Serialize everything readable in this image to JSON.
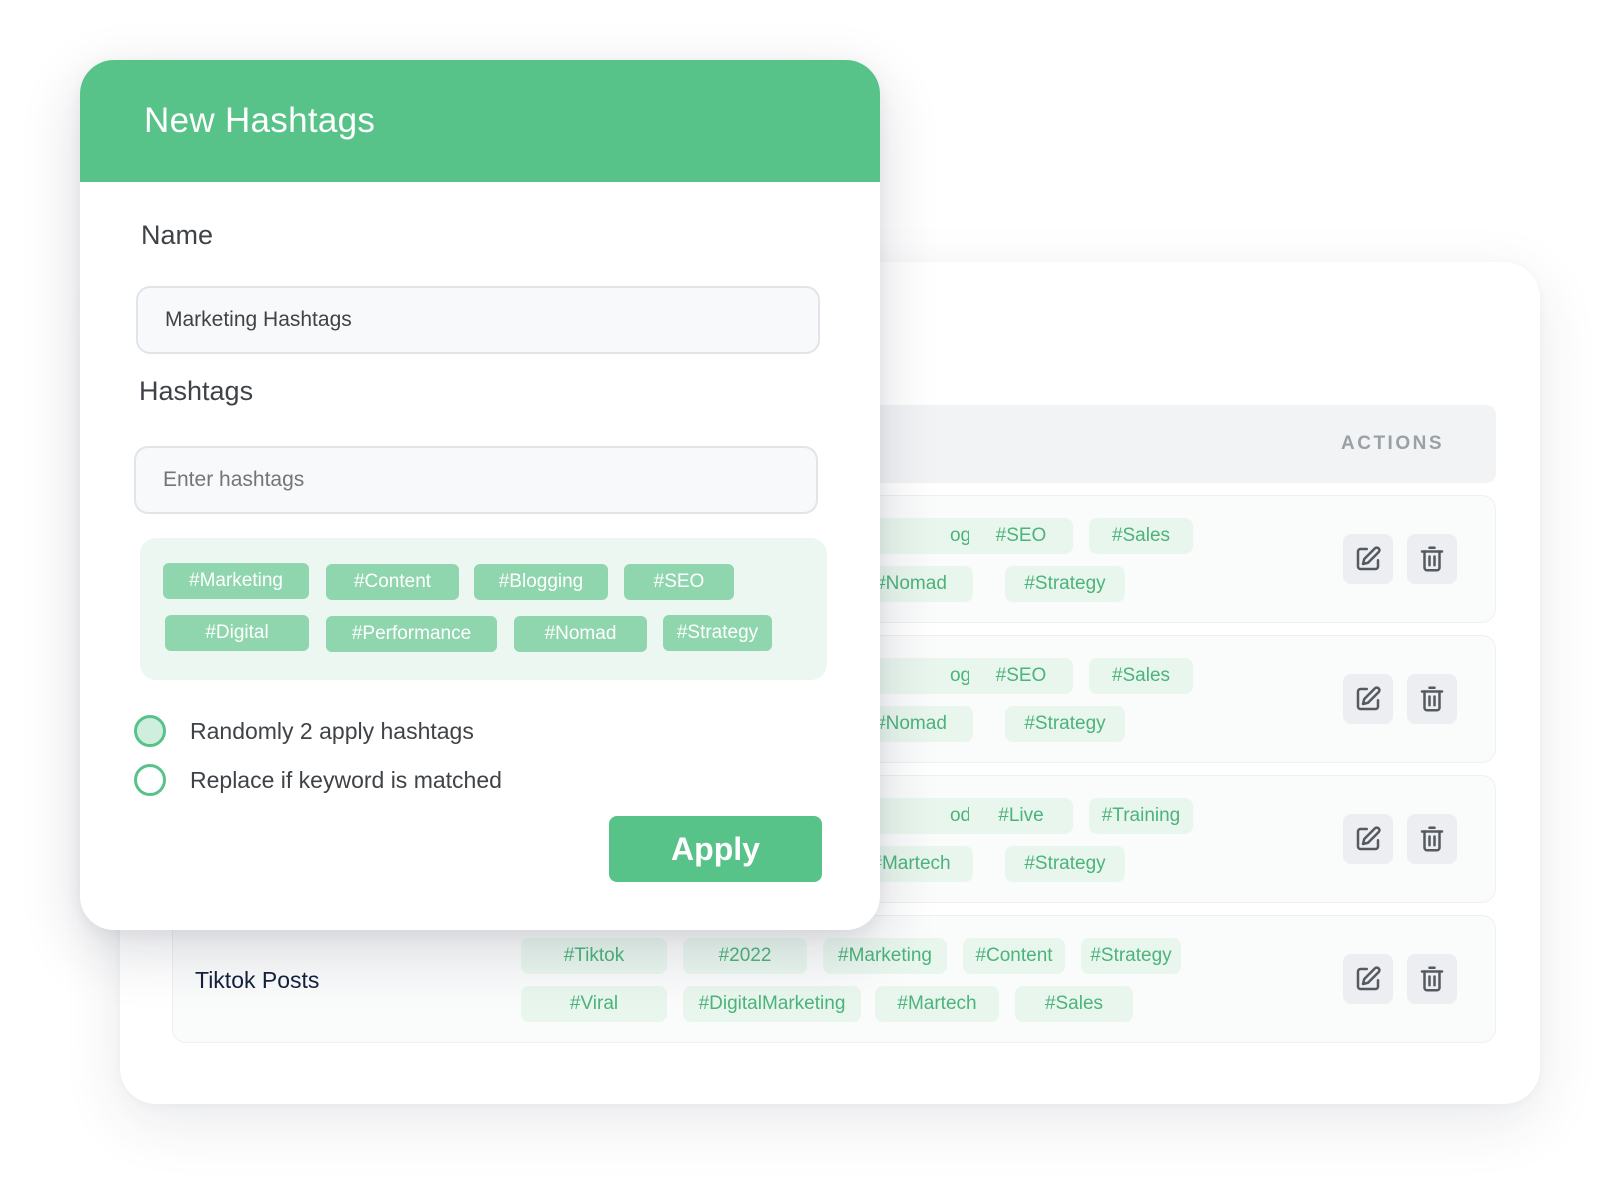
{
  "modal": {
    "title": "New Hashtags",
    "name_label": "Name",
    "name_value": "Marketing Hashtags",
    "hashtags_label": "Hashtags",
    "hashtags_placeholder": "Enter hashtags",
    "tags": [
      "#Marketing",
      "#Content",
      "#Blogging",
      "#SEO",
      "#Digital",
      "#Performance",
      "#Nomad",
      "#Strategy"
    ],
    "options": [
      {
        "label": "Randomly 2 apply hashtags",
        "checked": true
      },
      {
        "label": "Replace if keyword is matched",
        "checked": false
      }
    ],
    "apply_label": "Apply",
    "accent_color": "#58c389"
  },
  "table": {
    "actions_header": "ACTIONS",
    "rows": [
      {
        "name": "",
        "tags_row1": [
          "ogging",
          "#SEO",
          "#Sales"
        ],
        "tags_row2": [
          "#Nomad",
          "#Strategy"
        ]
      },
      {
        "name": "",
        "tags_row1": [
          "ogging",
          "#SEO",
          "#Sales"
        ],
        "tags_row2": [
          "#Nomad",
          "#Strategy"
        ]
      },
      {
        "name": "",
        "tags_row1": [
          "odates",
          "#Live",
          "#Training"
        ],
        "tags_row2": [
          "#Martech",
          "#Strategy"
        ]
      },
      {
        "name": "Tiktok Posts",
        "tags_row1": [
          "#Tiktok",
          "#2022",
          "#Marketing",
          "#Content",
          "#Strategy"
        ],
        "tags_row2": [
          "#Viral",
          "#DigitalMarketing",
          "#Martech",
          "#Sales"
        ]
      }
    ],
    "row_actions": [
      {
        "icon": "edit-icon"
      },
      {
        "icon": "trash-icon"
      }
    ]
  }
}
